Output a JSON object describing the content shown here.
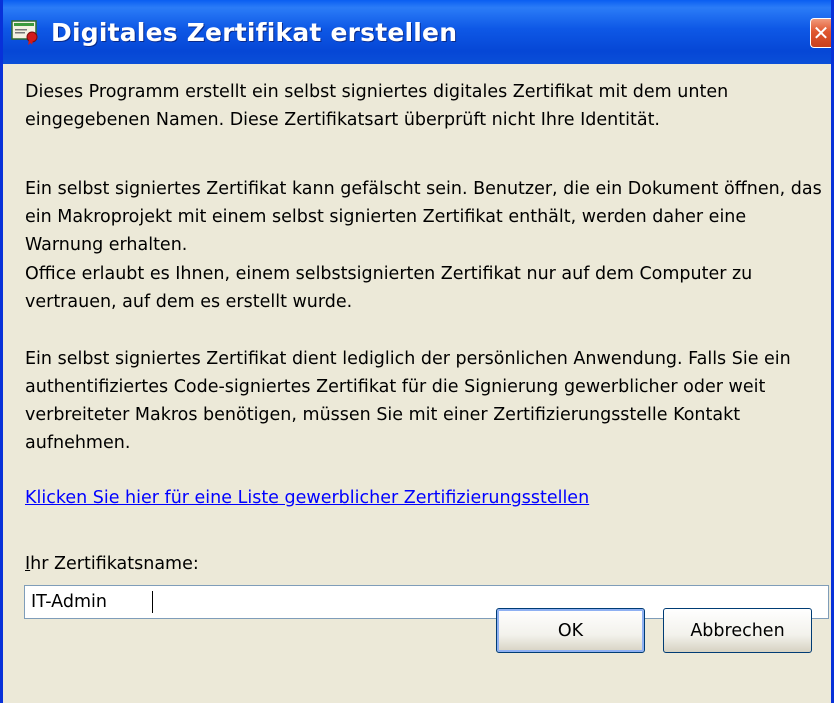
{
  "window": {
    "title": "Digitales Zertifikat erstellen",
    "close_glyph": "✕"
  },
  "body": {
    "para1": "Dieses Programm erstellt ein selbst signiertes digitales Zertifikat mit dem unten eingegebenen Namen. Diese Zertifikatsart überprüft nicht Ihre Identität.",
    "para2": "Ein selbst signiertes Zertifikat kann gefälscht sein. Benutzer, die ein Dokument öffnen, das ein Makroprojekt mit einem selbst signierten Zertifikat enthält, werden daher eine Warnung erhalten.",
    "para3": "Office erlaubt es Ihnen, einem selbstsignierten Zertifikat nur auf dem Computer zu vertrauen, auf dem es erstellt wurde.",
    "para4": "Ein selbst signiertes Zertifikat dient lediglich der persönlichen Anwendung. Falls Sie ein authentifiziertes Code-signiertes Zertifikat für die Signierung gewerblicher oder weit verbreiteter Makros benötigen, müssen Sie mit einer Zertifizierungsstelle Kontakt aufnehmen.",
    "link": "Klicken Sie hier für eine Liste gewerblicher Zertifizierungsstellen"
  },
  "form": {
    "label_accel": "I",
    "label_rest": "hr Zertifikatsname:",
    "name_value": "IT-Admin"
  },
  "buttons": {
    "ok": "OK",
    "cancel": "Abbrechen"
  },
  "icons": {
    "title_icon": "certificate-icon",
    "close_icon": "close-icon"
  },
  "colors": {
    "titlebar": "#0a5ef2",
    "dialog_bg": "#ece9d8",
    "link": "#0000ff",
    "close": "#e0572f"
  }
}
